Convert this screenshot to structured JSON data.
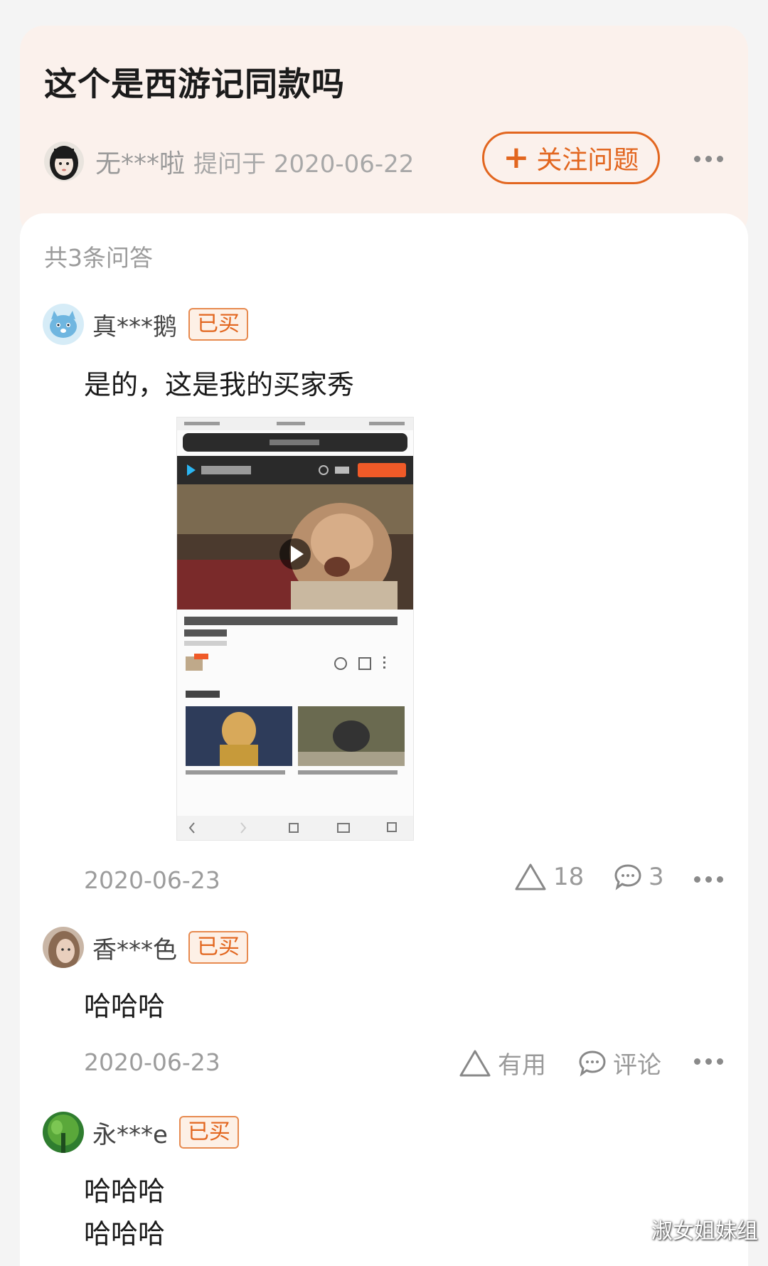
{
  "question": {
    "title": "这个是西游记同款吗",
    "asker_name": "无***啦",
    "asker_meta": "提问于 2020-06-22",
    "follow_label": "关注问题"
  },
  "answers_count": "共3条问答",
  "answers": [
    {
      "user": "真***鹅",
      "badge": "已买",
      "text": "是的，这是我的买家秀",
      "date": "2020-06-23",
      "likes": "18",
      "comments": "3",
      "has_image": true
    },
    {
      "user": "香***色",
      "badge": "已买",
      "text": "哈哈哈",
      "date": "2020-06-23",
      "useful_label": "有用",
      "comment_label": "评论"
    },
    {
      "user": "永***e",
      "badge": "已买",
      "text_lines": [
        "哈哈哈",
        "哈哈哈"
      ]
    }
  ],
  "watermark": "淑女姐妹组",
  "colors": {
    "accent": "#e2661f",
    "top_bg": "#fbf1ec"
  }
}
